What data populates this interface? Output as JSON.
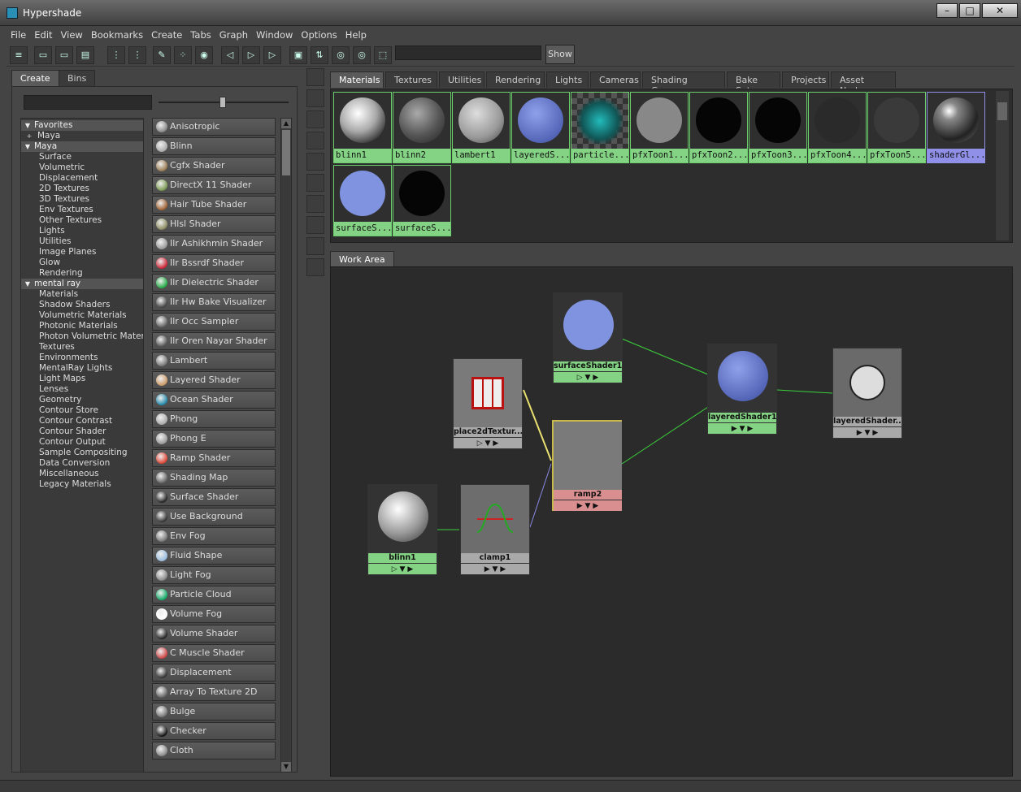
{
  "window": {
    "title": "Hypershade",
    "controls": [
      "–",
      "□",
      "✕"
    ]
  },
  "menubar": [
    "File",
    "Edit",
    "View",
    "Bookmarks",
    "Create",
    "Tabs",
    "Graph",
    "Window",
    "Options",
    "Help"
  ],
  "toolbar": {
    "show_label": "Show"
  },
  "left_panel": {
    "tabs": [
      "Create",
      "Bins"
    ],
    "tree": [
      {
        "label": "Favorites",
        "type": "section",
        "expanded": true
      },
      {
        "label": "Maya",
        "type": "child-plus"
      },
      {
        "label": "Maya",
        "type": "section",
        "expanded": true
      },
      {
        "label": "Surface",
        "type": "item"
      },
      {
        "label": "Volumetric",
        "type": "item"
      },
      {
        "label": "Displacement",
        "type": "item"
      },
      {
        "label": "2D Textures",
        "type": "item"
      },
      {
        "label": "3D Textures",
        "type": "item"
      },
      {
        "label": "Env Textures",
        "type": "item"
      },
      {
        "label": "Other Textures",
        "type": "item"
      },
      {
        "label": "Lights",
        "type": "item"
      },
      {
        "label": "Utilities",
        "type": "item"
      },
      {
        "label": "Image Planes",
        "type": "item"
      },
      {
        "label": "Glow",
        "type": "item"
      },
      {
        "label": "Rendering",
        "type": "item"
      },
      {
        "label": "mental ray",
        "type": "section",
        "expanded": true
      },
      {
        "label": "Materials",
        "type": "item"
      },
      {
        "label": "Shadow Shaders",
        "type": "item"
      },
      {
        "label": "Volumetric Materials",
        "type": "item"
      },
      {
        "label": "Photonic Materials",
        "type": "item"
      },
      {
        "label": "Photon Volumetric Materi...",
        "type": "item"
      },
      {
        "label": "Textures",
        "type": "item"
      },
      {
        "label": "Environments",
        "type": "item"
      },
      {
        "label": "MentalRay Lights",
        "type": "item"
      },
      {
        "label": "Light Maps",
        "type": "item"
      },
      {
        "label": "Lenses",
        "type": "item"
      },
      {
        "label": "Geometry",
        "type": "item"
      },
      {
        "label": "Contour Store",
        "type": "item"
      },
      {
        "label": "Contour Contrast",
        "type": "item"
      },
      {
        "label": "Contour Shader",
        "type": "item"
      },
      {
        "label": "Contour Output",
        "type": "item"
      },
      {
        "label": "Sample Compositing",
        "type": "item"
      },
      {
        "label": "Data Conversion",
        "type": "item"
      },
      {
        "label": "Miscellaneous",
        "type": "item"
      },
      {
        "label": "Legacy Materials",
        "type": "item"
      }
    ],
    "nodes": [
      "Anisotropic",
      "Blinn",
      "Cgfx Shader",
      "DirectX 11 Shader",
      "Hair Tube Shader",
      "Hlsl Shader",
      "Ilr Ashikhmin Shader",
      "Ilr Bssrdf Shader",
      "Ilr Dielectric Shader",
      "Ilr Hw Bake Visualizer",
      "Ilr Occ Sampler",
      "Ilr Oren Nayar Shader",
      "Lambert",
      "Layered Shader",
      "Ocean Shader",
      "Phong",
      "Phong E",
      "Ramp Shader",
      "Shading Map",
      "Surface Shader",
      "Use Background",
      "Env Fog",
      "Fluid Shape",
      "Light Fog",
      "Particle Cloud",
      "Volume Fog",
      "Volume Shader",
      "C Muscle Shader",
      "Displacement",
      "Array To Texture 2D",
      "Bulge",
      "Checker",
      "Cloth"
    ]
  },
  "top_tabs": [
    "Materials",
    "Textures",
    "Utilities",
    "Rendering",
    "Lights",
    "Cameras",
    "Shading Groups",
    "Bake Sets",
    "Projects",
    "Asset Nodes"
  ],
  "swatches": [
    {
      "label": "blinn1",
      "style": "blinn"
    },
    {
      "label": "blinn2",
      "style": "dark"
    },
    {
      "label": "lambert1",
      "style": "lambert"
    },
    {
      "label": "layeredS...",
      "style": "blue"
    },
    {
      "label": "particle...",
      "style": "checker"
    },
    {
      "label": "pfxToon1...",
      "style": "gray"
    },
    {
      "label": "pfxToon2...",
      "style": "black"
    },
    {
      "label": "pfxToon3...",
      "style": "black"
    },
    {
      "label": "pfxToon4...",
      "style": "dim"
    },
    {
      "label": "pfxToon5...",
      "style": "dim2"
    },
    {
      "label": "shaderGl...",
      "style": "glossy",
      "selected": true
    },
    {
      "label": "surfaceS...",
      "style": "blue-flat"
    },
    {
      "label": "surfaceS...",
      "style": "black"
    }
  ],
  "work_area": {
    "tab": "Work Area",
    "nodes": [
      {
        "id": "surfaceShader1",
        "label": "surfaceShader1",
        "color": "green"
      },
      {
        "id": "layeredShader1",
        "label": "layeredShader1",
        "color": "green"
      },
      {
        "id": "layeredShaderSG",
        "label": "layeredShader...",
        "color": "gray"
      },
      {
        "id": "place2dTexture",
        "label": "place2dTextur...",
        "color": "gray"
      },
      {
        "id": "ramp2",
        "label": "ramp2",
        "color": "pink"
      },
      {
        "id": "blinn1",
        "label": "blinn1",
        "color": "green"
      },
      {
        "id": "clamp1",
        "label": "clamp1",
        "color": "gray"
      }
    ]
  }
}
